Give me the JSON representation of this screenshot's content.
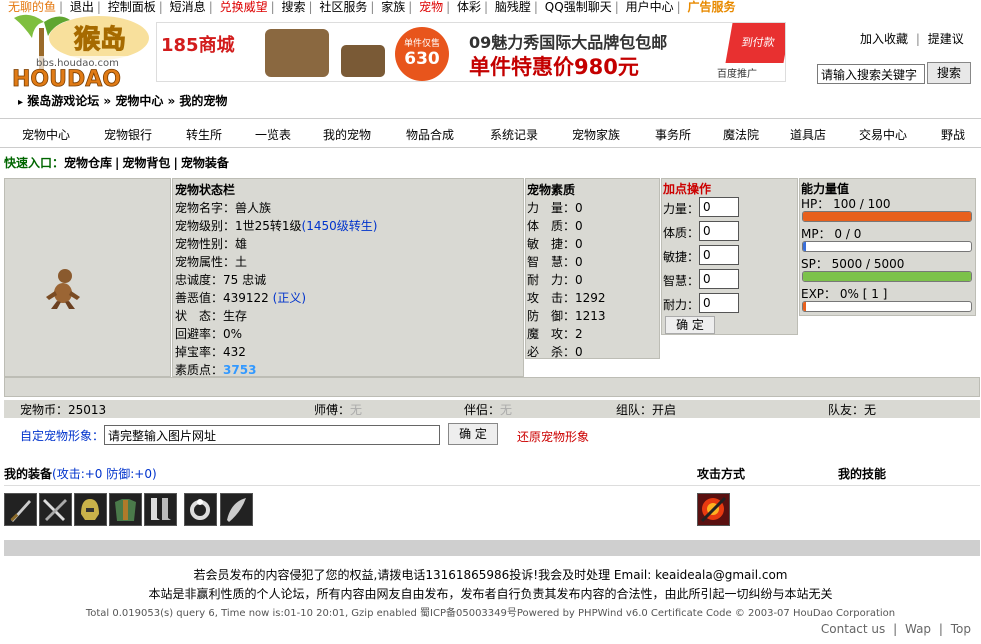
{
  "topnav": {
    "items": [
      "无聊的鱼",
      "退出",
      "控制面板",
      "短消息",
      "兑换威望",
      "搜索",
      "社区服务",
      "家族",
      "宠物",
      "体彩",
      "脑残膛",
      "QQ强制聊天",
      "用户中心",
      "广告服务"
    ]
  },
  "logo": {
    "text": "猴岛",
    "sub": "bbs.houdao.com",
    "brand": "HOUDAO"
  },
  "banner": {
    "store": "185商城",
    "price_tag_top": "单件仅售",
    "price_tag_num": "630",
    "headline": "09魅力秀国际大品牌包包邮",
    "subline": "单件特惠价980元",
    "corner": "到付款",
    "ad": "百度推广"
  },
  "header": {
    "favorite": "加入收藏",
    "suggest": "提建议",
    "search_placeholder": "请输入搜索关键字",
    "search_button": "搜索"
  },
  "breadcrumb": "猴岛游戏论坛 » 宠物中心 » 我的宠物",
  "mainnav": [
    "宠物中心",
    "宠物银行",
    "转生所",
    "一览表",
    "我的宠物",
    "物品合成",
    "系统记录",
    "宠物家族",
    "事务所",
    "魔法院",
    "道具店",
    "交易中心",
    "野战"
  ],
  "quick": {
    "label": "快速入口：",
    "links": [
      "宠物仓库",
      "宠物背包",
      "宠物装备"
    ]
  },
  "status": {
    "title": "宠物状态栏",
    "name": "宠物名字：兽人族",
    "level": "宠物级别：1世25转1级",
    "level_link": "(1450级转生)",
    "gender": "宠物性别：雄",
    "attr": "宠物属性：土",
    "loyalty": "忠诚度：75 忠诚",
    "goodevil": "善恶值：439122",
    "goodevil_tag": "(正义)",
    "state": "状　态：生存",
    "dodge": "回避率：0%",
    "drop": "掉宝率：432",
    "points_label": "素质点：",
    "points": "3753"
  },
  "quality": {
    "title": "宠物素质",
    "rows": [
      "力　量：0",
      "体　质：0",
      "敏　捷：0",
      "智　慧：0",
      "耐　力：0",
      "攻　击：1292",
      "防　御：1213",
      "魔　攻：2",
      "必　杀：0"
    ]
  },
  "addpoints": {
    "title": "加点操作",
    "labels": [
      "力量：",
      "体质：",
      "敏捷：",
      "智慧：",
      "耐力："
    ],
    "values": [
      "0",
      "0",
      "0",
      "0",
      "0"
    ],
    "button": "确 定"
  },
  "ability": {
    "title": "能力量值",
    "hp": "HP： 100 / 100",
    "mp": "MP： 0 / 0",
    "sp": "SP： 5000 / 5000",
    "exp": "EXP： 0% [ 1 ]",
    "hp_frac": 1.0,
    "mp_frac": 0.0,
    "sp_frac": 1.0,
    "exp_frac": 0.0,
    "hp_color": "#e8601c",
    "sp_color": "#7cc24a",
    "exp_color": "#e8601c"
  },
  "inforow": {
    "coins": "宠物币：25013",
    "master_label": "师傅：",
    "master": "无",
    "partner_label": "伴侣：",
    "partner": "无",
    "team_label": "组队：",
    "team": "开启",
    "mate_label": "队友：",
    "mate": "无"
  },
  "custom": {
    "label": "自定宠物形象：",
    "value": "请完整输入图片网址",
    "button": "确 定",
    "restore": "还原宠物形象"
  },
  "equip": {
    "label": "我的装备",
    "stats": "(攻击:+0 防御:+0)",
    "attack_label": "攻击方式",
    "skills_label": "我的技能"
  },
  "footer": {
    "line1": "若会员发布的内容侵犯了您的权益,请拨电话13161865986投诉!我会及时处理 Email: keaideala@gmail.com",
    "line2": "本站是非赢利性质的个人论坛，所有内容由网友自由发布，发布者自行负责其发布内容的合法性，由此所引起一切纠纷与本站无关",
    "line3": "Total 0.019053(s) query 6, Time now is:01-10 20:01, Gzip enabled 蜀ICP备05003349号Powered by PHPWind v6.0 Certificate Code © 2003-07 HouDao Corporation",
    "links": [
      "Contact us",
      "Wap",
      "Top"
    ]
  }
}
